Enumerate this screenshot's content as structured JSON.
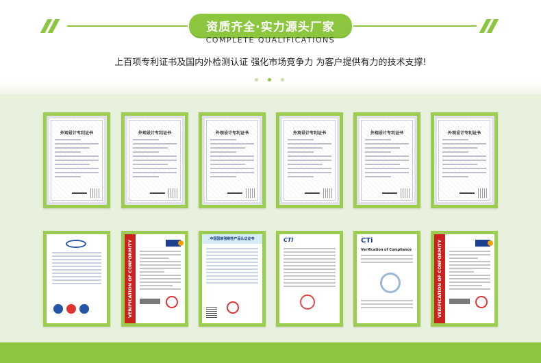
{
  "header": {
    "title": "资质齐全·实力源头厂家",
    "subtitle": "COMPLETE QUALIFICATIONS",
    "description": "上百项专利证书及国内外检测认证 强化市场竞争力 为客户提供有力的技术支撑!",
    "dots_active_index": 1,
    "dots_count": 3
  },
  "row1": [
    {
      "type": "patent",
      "title": "外观设计专利证书"
    },
    {
      "type": "patent",
      "title": "外观设计专利证书"
    },
    {
      "type": "patent",
      "title": "外观设计专利证书"
    },
    {
      "type": "patent",
      "title": "外观设计专利证书"
    },
    {
      "type": "patent",
      "title": "外观设计专利证书"
    },
    {
      "type": "patent",
      "title": "外观设计专利证书"
    }
  ],
  "row2": [
    {
      "type": "quality-system"
    },
    {
      "type": "conformity",
      "banner": "VERIFICATION OF CONFORMITY"
    },
    {
      "type": "ccc",
      "title": "中国国家强制性产品认证证书"
    },
    {
      "type": "cti-report",
      "logo": "CTI"
    },
    {
      "type": "cti-compliance",
      "logo": "CTi",
      "title": "Verification of Compliance"
    },
    {
      "type": "conformity",
      "banner": "VERIFICATION OF CONFORMITY"
    }
  ],
  "colors": {
    "accent": "#8cc63f",
    "background": "#e8f1dd",
    "conformity_red": "#c8231f"
  }
}
